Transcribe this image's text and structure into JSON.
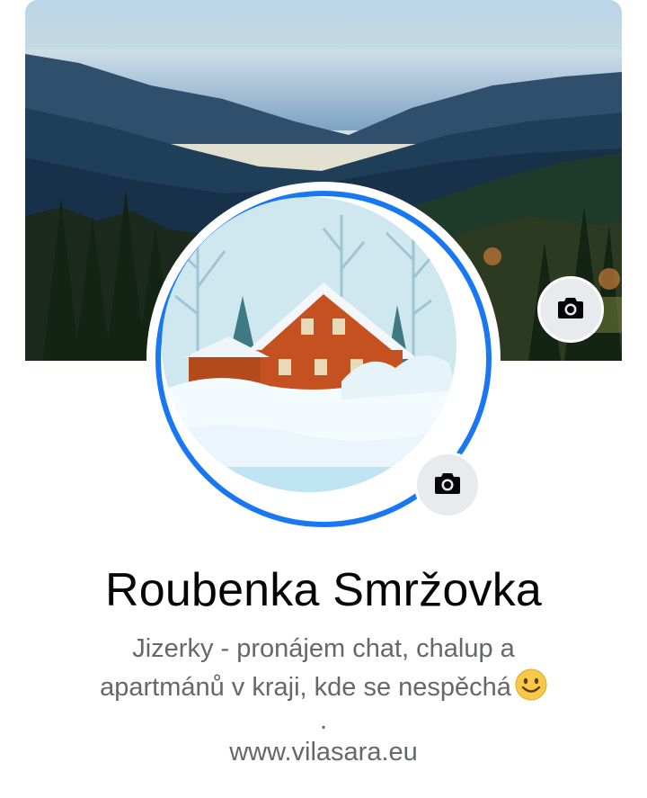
{
  "profile": {
    "name": "Roubenka Smržovka",
    "bio_line1": "Jizerky - pronájem chat,  chalup a",
    "bio_line2": "apartmánů v kraji, kde se nespěchá",
    "bio_dot": ".",
    "website": "www.vilasara.eu"
  },
  "icons": {
    "cover_camera": "camera-icon",
    "avatar_camera": "camera-icon",
    "emoji": "smiling-face-emoji"
  },
  "colors": {
    "ring": "#1877f2",
    "name": "#050505",
    "secondary_text": "#65676b",
    "camera_button_bg": "#e9eaee"
  }
}
